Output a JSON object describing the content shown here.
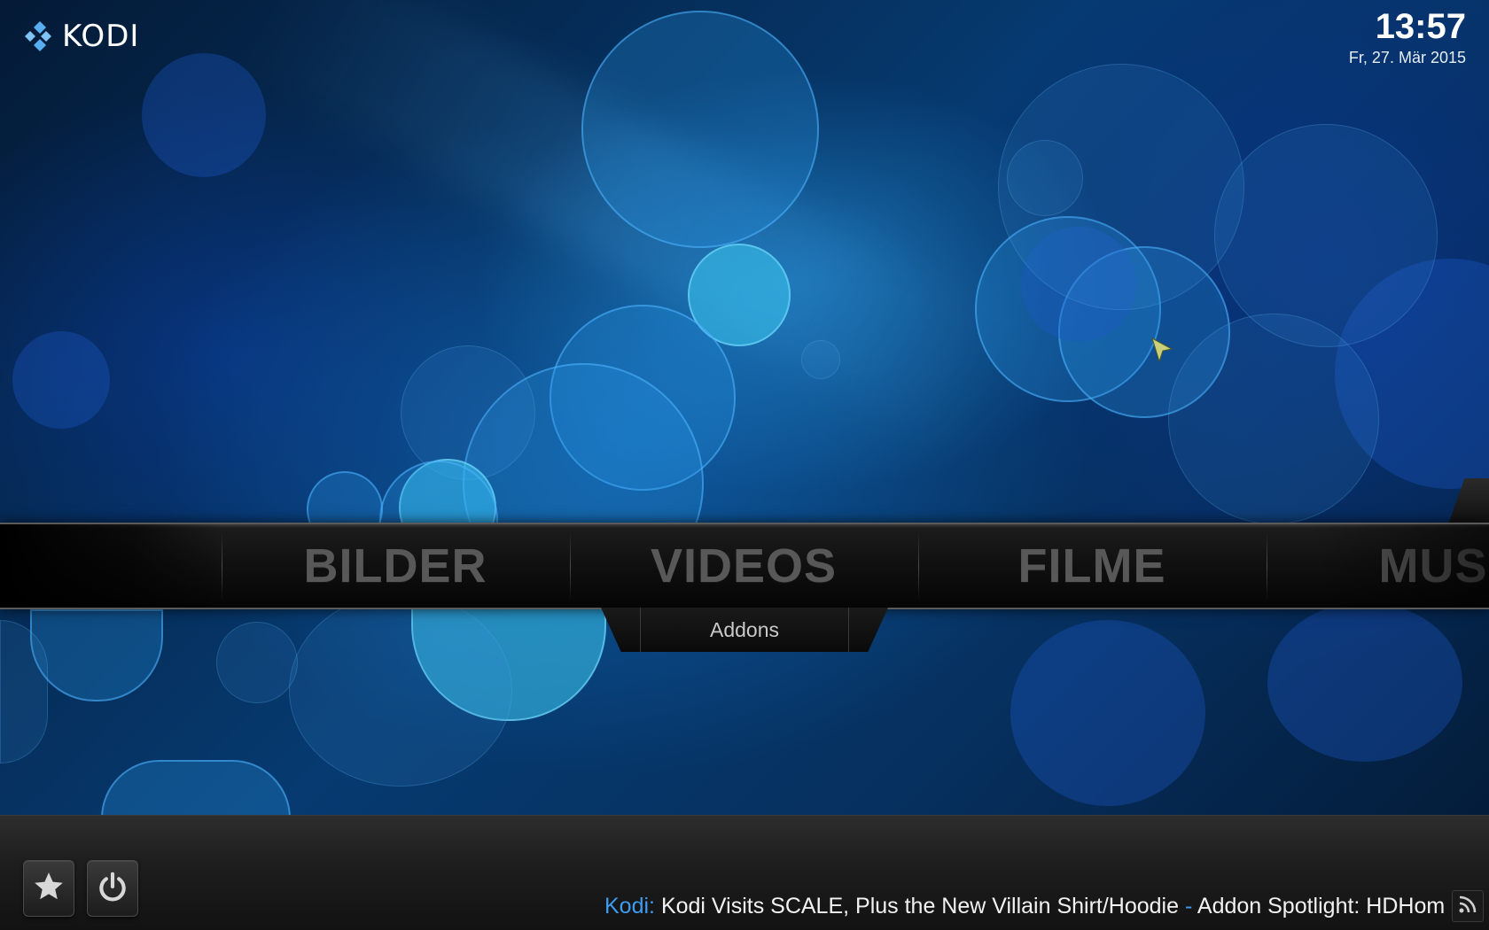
{
  "app": {
    "logo_text": "KODI",
    "logo_icon": "kodi-diamond-icon"
  },
  "clock": {
    "time": "13:57",
    "date": "Fr, 27. Mär 2015"
  },
  "main_menu": {
    "items": [
      {
        "label": "BILDER"
      },
      {
        "label": "VIDEOS"
      },
      {
        "label": "FILME"
      },
      {
        "label": "MUSI"
      }
    ],
    "selected_index": 1
  },
  "submenu": {
    "items": [
      {
        "label": "Addons"
      }
    ]
  },
  "bottom_bar": {
    "favourites_icon": "star-icon",
    "power_icon": "power-icon",
    "rss_icon": "rss-icon",
    "ticker": {
      "source": "Kodi:",
      "headline_1": "Kodi Visits SCALE, Plus the New Villain Shirt/Hoodie",
      "separator": "-",
      "headline_2": "Addon Spotlight: HDHomeRun Live T"
    }
  },
  "colors": {
    "accent": "#3d9cf0",
    "menu_text": "#585858",
    "background_blue": "#063a70"
  }
}
